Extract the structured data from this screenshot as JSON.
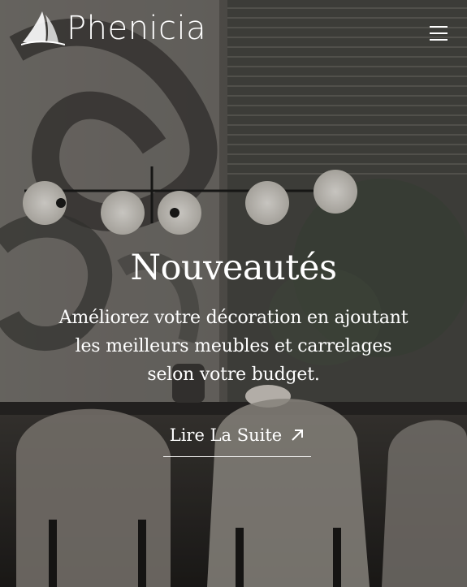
{
  "brand": {
    "name": "Phenicia",
    "accent": "#d23a3a"
  },
  "header": {
    "menu_icon": "hamburger-icon"
  },
  "hero": {
    "title": "Nouveautés",
    "subtitle": "Améliorez votre décoration en ajoutant les meilleurs meubles et carrelages selon votre budget.",
    "cta_label": "Lire La Suite",
    "cta_icon": "arrow-up-right-icon"
  }
}
